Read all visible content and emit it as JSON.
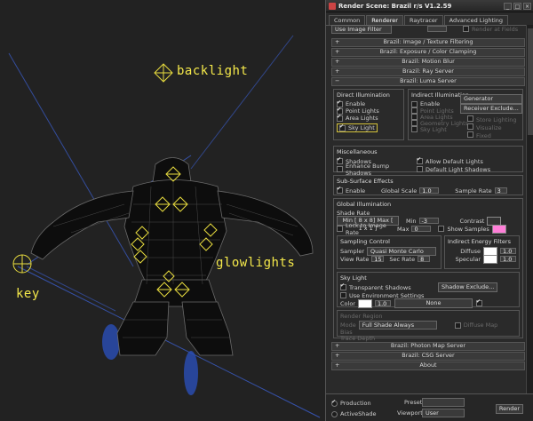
{
  "viewport": {
    "labels": {
      "backlight": "backlight",
      "glowlights": "glowlights",
      "key": "key"
    }
  },
  "panel": {
    "title": "Render Scene: Brazil r/s V1.2.59",
    "tabs": [
      "Common",
      "Renderer",
      "Raytracer",
      "Advanced Lighting"
    ],
    "top_row": {
      "dropdown": "Use Image Filter",
      "check": "Render at Fields"
    },
    "rollouts_top": [
      "Brazil: Image / Texture Filtering",
      "Brazil: Exposure / Color Clamping",
      "Brazil: Motion Blur",
      "Brazil: Ray Server",
      "Brazil: Luma Server"
    ],
    "direct": {
      "title": "Direct Illumination",
      "items": [
        "Enable",
        "Point Lights",
        "Area Lights",
        "Sky Light"
      ]
    },
    "indirect": {
      "title": "Indirect Illumination",
      "items": [
        "Enable",
        "Point Lights",
        "Area Lights",
        "Geometry Lights",
        "Sky Light"
      ],
      "right_items": [
        "Store Lighting",
        "Visualize",
        "Fixed"
      ],
      "buttons": [
        "Generator Exclude...",
        "Receiver Exclude..."
      ]
    },
    "misc": {
      "title": "Miscellaneous",
      "items": [
        "Shadows",
        "Allow Default Lights",
        "Enhance Bump Shadows",
        "Default Light Shadows"
      ]
    },
    "sss": {
      "title": "Sub-Surface Effects",
      "enable": "Enable",
      "global_scale_label": "Global Scale",
      "global_scale": "1.0",
      "sample_rate_label": "Sample Rate",
      "sample_rate": "3"
    },
    "gi": {
      "title": "Global Illumination",
      "shade_rate": "Shade Rate",
      "minmax_text": "Min [ 8 x 8]  Max [ 1 x 1 ]",
      "min_label": "Min",
      "min_value": "-3",
      "max_label": "Max",
      "max_value": "0",
      "lock": "Lock to Image Rate",
      "contrast": "Contrast",
      "show_samples": "Show Samples",
      "show_samples_color": "#ff7fd8"
    },
    "sampling": {
      "title": "Sampling Control",
      "sampler_label": "Sampler",
      "sampler": "Quasi Monte Carlo",
      "view_rate_label": "View Rate",
      "view_rate": "15",
      "sec_rate_label": "Sec Rate",
      "sec_rate": "8",
      "energy_title": "Indirect Energy Filters",
      "diffuse_label": "Diffuse",
      "diffuse": "1.0",
      "specular_label": "Specular",
      "specular": "1.0"
    },
    "skylight": {
      "title": "Sky Light",
      "transparent": "Transparent Shadows",
      "use_env": "Use Environment Settings",
      "shadow_exclude": "Shadow Exclude...",
      "color_label": "Color",
      "color_value": "1.0",
      "none": "None"
    },
    "render_region": {
      "title": "Render Region",
      "mode_label": "Mode",
      "mode": "Full Shade Always",
      "diffuse_map": "Diffuse Map",
      "bias_label": "Bias",
      "depth_label": "Trace Depth"
    },
    "rollouts_bottom": [
      "Brazil: Photon Map Server",
      "Brazil: CSG Server",
      "About"
    ],
    "bottom": {
      "production": "Production",
      "activeshade": "ActiveShade",
      "preset_label": "Preset:",
      "viewport_label": "Viewport:",
      "viewport_value": "User",
      "render": "Render"
    }
  }
}
